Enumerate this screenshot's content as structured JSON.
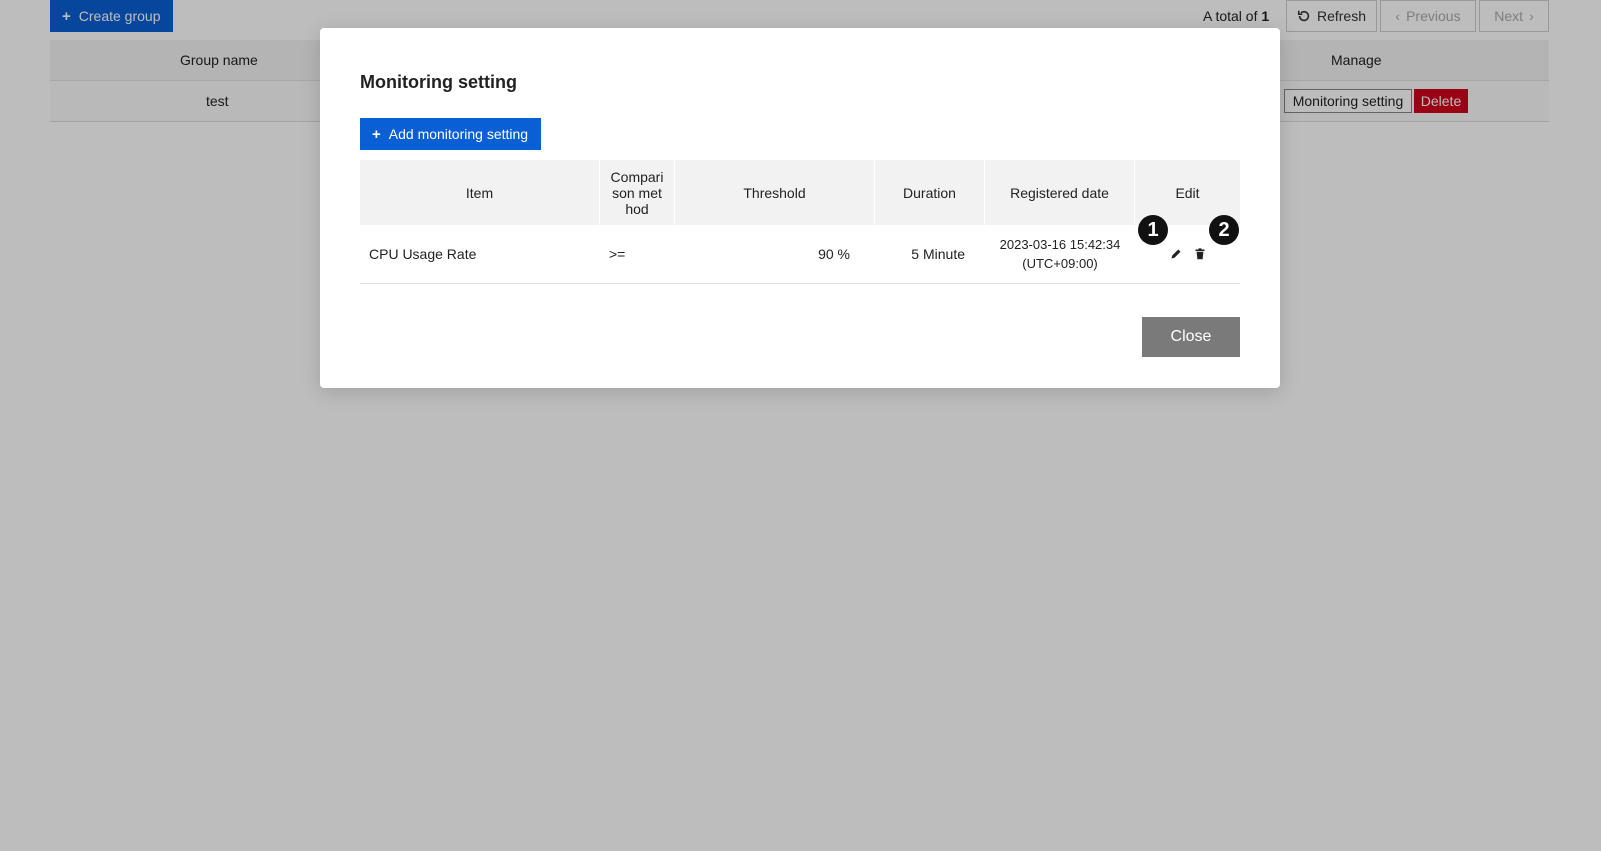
{
  "background": {
    "toolbar": {
      "create_group_label": "Create group",
      "total_prefix": "A total of",
      "total_count": "1",
      "refresh_label": "Refresh",
      "previous_label": "Previous",
      "next_label": "Next"
    },
    "table": {
      "headers": {
        "group_name": "Group name",
        "manage": "Manage"
      },
      "rows": [
        {
          "group_name": "test",
          "monitoring_setting_label": "Monitoring setting",
          "delete_label": "Delete"
        }
      ]
    }
  },
  "modal": {
    "title": "Monitoring setting",
    "add_label": "Add monitoring setting",
    "columns": {
      "item": "Item",
      "comparison": "Compari son met hod",
      "threshold": "Threshold",
      "duration": "Duration",
      "registered": "Registered date",
      "edit": "Edit"
    },
    "rows": [
      {
        "item": "CPU Usage Rate",
        "comparison": ">=",
        "threshold": "90 %",
        "duration": "5 Minute",
        "registered_line1": "2023-03-16 15:42:34",
        "registered_line2": "(UTC+09:00)"
      }
    ],
    "markers": {
      "edit": "1",
      "delete": "2"
    },
    "close_label": "Close"
  },
  "colors": {
    "primary": "#0a5fd4",
    "danger": "#d0021b",
    "close": "#7a7a7a",
    "overlay": "rgba(0,0,0,0.26)"
  },
  "icons": {
    "create": "plus-icon",
    "refresh": "refresh-icon",
    "previous": "chevron-left-icon",
    "next": "chevron-right-icon",
    "edit": "pencil-icon",
    "delete": "trash-icon"
  }
}
